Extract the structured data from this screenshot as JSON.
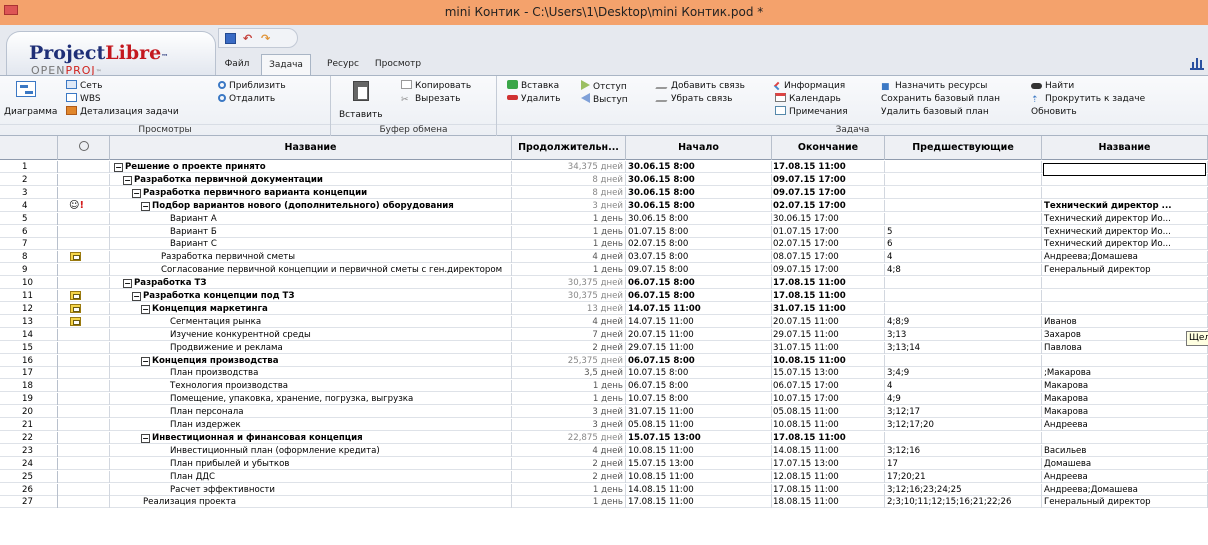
{
  "window": {
    "title": "mini Контик - C:\\Users\\1\\Desktop\\mini Контик.pod *"
  },
  "logo": {
    "main_a": "Project",
    "main_b": "Libre",
    "tm": "™",
    "sub_a": "OPEN",
    "sub_b": "PROJ",
    "sub_tm": "™"
  },
  "tabs": {
    "file": "Файл",
    "task": "Задача",
    "resource": "Ресурс",
    "view": "Просмотр"
  },
  "ribbon": {
    "views": {
      "title": "Просмотры",
      "diagram": "Диаграмма",
      "network": "Сеть",
      "wbs": "WBS",
      "task_detail": "Детализация задачи",
      "zoom_in": "Приблизить",
      "zoom_out": "Отдалить"
    },
    "clipboard": {
      "title": "Буфер обмена",
      "paste": "Вставить",
      "copy": "Копировать",
      "cut": "Вырезать"
    },
    "task": {
      "title": "Задача",
      "insert": "Вставка",
      "delete": "Удалить",
      "indent": "Отступ",
      "outdent": "Выступ",
      "add_link": "Добавить связь",
      "remove_link": "Убрать связь",
      "info": "Информация",
      "calendar": "Календарь",
      "notes": "Примечания",
      "assign_resources": "Назначить ресурсы",
      "save_baseline": "Сохранить базовый план",
      "clear_baseline": "Удалить базовый план",
      "find": "Найти",
      "scroll_to_task": "Прокрутить к задаче",
      "refresh": "Обновить"
    }
  },
  "table": {
    "columns": [
      "Название",
      "Продолжительн...",
      "Начало",
      "Окончание",
      "Предшествующие",
      "Название"
    ],
    "rows": [
      {
        "num": "1",
        "icon": "",
        "level": 0,
        "summary": true,
        "name": "Решение о проекте принято",
        "dur": "34,375 дней",
        "start": "30.06.15 8:00",
        "end": "17.08.15 11:00",
        "pred": "",
        "res": ""
      },
      {
        "num": "2",
        "icon": "",
        "level": 1,
        "summary": true,
        "name": "Разработка первичной документации",
        "dur": "8 дней",
        "start": "30.06.15 8:00",
        "end": "09.07.15 17:00",
        "pred": "",
        "res": ""
      },
      {
        "num": "3",
        "icon": "",
        "level": 2,
        "summary": true,
        "name": "Разработка первичного варианта концепции",
        "dur": "8 дней",
        "start": "30.06.15 8:00",
        "end": "09.07.15 17:00",
        "pred": "",
        "res": ""
      },
      {
        "num": "4",
        "icon": "person",
        "level": 3,
        "summary": true,
        "name": "Подбор вариантов нового (дополнительного) оборудования",
        "dur": "3 дней",
        "start": "30.06.15 8:00",
        "end": "02.07.15 17:00",
        "pred": "",
        "res": "Технический директор ..."
      },
      {
        "num": "5",
        "icon": "",
        "level": 4,
        "summary": false,
        "name": "Вариант А",
        "dur": "1 день",
        "start": "30.06.15 8:00",
        "end": "30.06.15 17:00",
        "pred": "",
        "res": "Технический директор Ио..."
      },
      {
        "num": "6",
        "icon": "",
        "level": 4,
        "summary": false,
        "name": "Вариант Б",
        "dur": "1 день",
        "start": "01.07.15 8:00",
        "end": "01.07.15 17:00",
        "pred": "5",
        "res": "Технический директор Ио..."
      },
      {
        "num": "7",
        "icon": "",
        "level": 4,
        "summary": false,
        "name": "Вариант С",
        "dur": "1 день",
        "start": "02.07.15 8:00",
        "end": "02.07.15 17:00",
        "pred": "6",
        "res": "Технический директор Ио..."
      },
      {
        "num": "8",
        "icon": "task",
        "level": 3,
        "summary": false,
        "name": "Разработка первичной сметы",
        "dur": "4 дней",
        "start": "03.07.15 8:00",
        "end": "08.07.15 17:00",
        "pred": "4",
        "res": "Андреева;Домашева"
      },
      {
        "num": "9",
        "icon": "",
        "level": 3,
        "summary": false,
        "name": "Согласование первичной концепции и первичной сметы с ген.директором",
        "dur": "1 день",
        "start": "09.07.15 8:00",
        "end": "09.07.15 17:00",
        "pred": "4;8",
        "res": "Генеральный директор"
      },
      {
        "num": "10",
        "icon": "",
        "level": 1,
        "summary": true,
        "name": "Разработка ТЗ",
        "dur": "30,375 дней",
        "start": "06.07.15 8:00",
        "end": "17.08.15 11:00",
        "pred": "",
        "res": ""
      },
      {
        "num": "11",
        "icon": "task",
        "level": 2,
        "summary": true,
        "name": "Разработка концепции под ТЗ",
        "dur": "30,375 дней",
        "start": "06.07.15 8:00",
        "end": "17.08.15 11:00",
        "pred": "",
        "res": ""
      },
      {
        "num": "12",
        "icon": "task",
        "level": 3,
        "summary": true,
        "name": "Концепция маркетинга",
        "dur": "13 дней",
        "start": "14.07.15 11:00",
        "end": "31.07.15 11:00",
        "pred": "",
        "res": ""
      },
      {
        "num": "13",
        "icon": "task",
        "level": 4,
        "summary": false,
        "name": "Сегментация рынка",
        "dur": "4 дней",
        "start": "14.07.15 11:00",
        "end": "20.07.15 11:00",
        "pred": "4;8;9",
        "res": "Иванов"
      },
      {
        "num": "14",
        "icon": "",
        "level": 4,
        "summary": false,
        "name": "Изучение конкурентной среды",
        "dur": "7 дней",
        "start": "20.07.15 11:00",
        "end": "29.07.15 11:00",
        "pred": "3;13",
        "res": "Захаров"
      },
      {
        "num": "15",
        "icon": "",
        "level": 4,
        "summary": false,
        "name": "Продвижение и реклама",
        "dur": "2 дней",
        "start": "29.07.15 11:00",
        "end": "31.07.15 11:00",
        "pred": "3;13;14",
        "res": "Павлова"
      },
      {
        "num": "16",
        "icon": "",
        "level": 3,
        "summary": true,
        "name": "Концепция производства",
        "dur": "25,375 дней",
        "start": "06.07.15 8:00",
        "end": "10.08.15 11:00",
        "pred": "",
        "res": ""
      },
      {
        "num": "17",
        "icon": "",
        "level": 4,
        "summary": false,
        "name": "План производства",
        "dur": "3,5 дней",
        "start": "10.07.15 8:00",
        "end": "15.07.15 13:00",
        "pred": "3;4;9",
        "res": ";Макарова"
      },
      {
        "num": "18",
        "icon": "",
        "level": 4,
        "summary": false,
        "name": "Технология производства",
        "dur": "1 день",
        "start": "06.07.15 8:00",
        "end": "06.07.15 17:00",
        "pred": "4",
        "res": "Макарова"
      },
      {
        "num": "19",
        "icon": "",
        "level": 4,
        "summary": false,
        "name": "Помещение, упаковка, хранение, погрузка, выгрузка",
        "dur": "1 день",
        "start": "10.07.15 8:00",
        "end": "10.07.15 17:00",
        "pred": "4;9",
        "res": "Макарова"
      },
      {
        "num": "20",
        "icon": "",
        "level": 4,
        "summary": false,
        "name": "План персонала",
        "dur": "3 дней",
        "start": "31.07.15 11:00",
        "end": "05.08.15 11:00",
        "pred": "3;12;17",
        "res": "Макарова"
      },
      {
        "num": "21",
        "icon": "",
        "level": 4,
        "summary": false,
        "name": "План издержек",
        "dur": "3 дней",
        "start": "05.08.15 11:00",
        "end": "10.08.15 11:00",
        "pred": "3;12;17;20",
        "res": "Андреева"
      },
      {
        "num": "22",
        "icon": "",
        "level": 3,
        "summary": true,
        "name": "Инвестиционная и финансовая концепция",
        "dur": "22,875 дней",
        "start": "15.07.15 13:00",
        "end": "17.08.15 11:00",
        "pred": "",
        "res": ""
      },
      {
        "num": "23",
        "icon": "",
        "level": 4,
        "summary": false,
        "name": "Инвестиционный план (оформление кредита)",
        "dur": "4 дней",
        "start": "10.08.15 11:00",
        "end": "14.08.15 11:00",
        "pred": "3;12;16",
        "res": "Васильев"
      },
      {
        "num": "24",
        "icon": "",
        "level": 4,
        "summary": false,
        "name": "План прибылей и убытков",
        "dur": "2 дней",
        "start": "15.07.15 13:00",
        "end": "17.07.15 13:00",
        "pred": "17",
        "res": "Домашева"
      },
      {
        "num": "25",
        "icon": "",
        "level": 4,
        "summary": false,
        "name": "План ДДС",
        "dur": "2 дней",
        "start": "10.08.15 11:00",
        "end": "12.08.15 11:00",
        "pred": "17;20;21",
        "res": "Андреева"
      },
      {
        "num": "26",
        "icon": "",
        "level": 4,
        "summary": false,
        "name": "Расчет эффективности",
        "dur": "1 день",
        "start": "14.08.15 11:00",
        "end": "17.08.15 11:00",
        "pred": "3;12;16;23;24;25",
        "res": "Андреева;Домашева"
      },
      {
        "num": "27",
        "icon": "",
        "level": 1,
        "summary": false,
        "name": "Реализация проекта",
        "dur": "1 день",
        "start": "17.08.15 11:00",
        "end": "18.08.15 11:00",
        "pred": "2;3;10;11;12;15;16;21;22;26",
        "res": "Генеральный директор"
      }
    ]
  },
  "tooltip": {
    "text": "Щел"
  }
}
